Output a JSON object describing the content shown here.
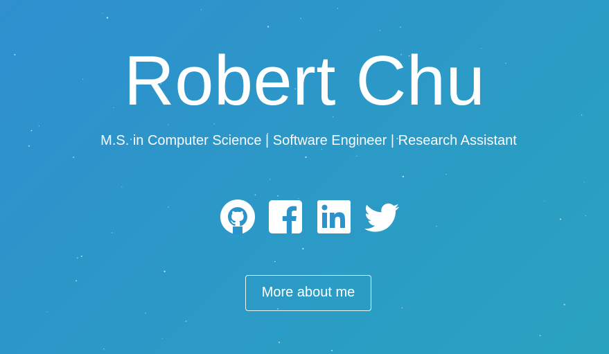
{
  "hero": {
    "name": "Robert Chu",
    "tagline": "M.S. in Computer Science | Software Engineer | Research Assistant",
    "cta_label": "More about me"
  },
  "socials": [
    {
      "icon": "github-icon"
    },
    {
      "icon": "facebook-icon"
    },
    {
      "icon": "linkedin-icon"
    },
    {
      "icon": "twitter-icon"
    }
  ],
  "colors": {
    "background_start": "#2f8fcf",
    "background_end": "#2aa3c0",
    "text": "#ffffff"
  }
}
